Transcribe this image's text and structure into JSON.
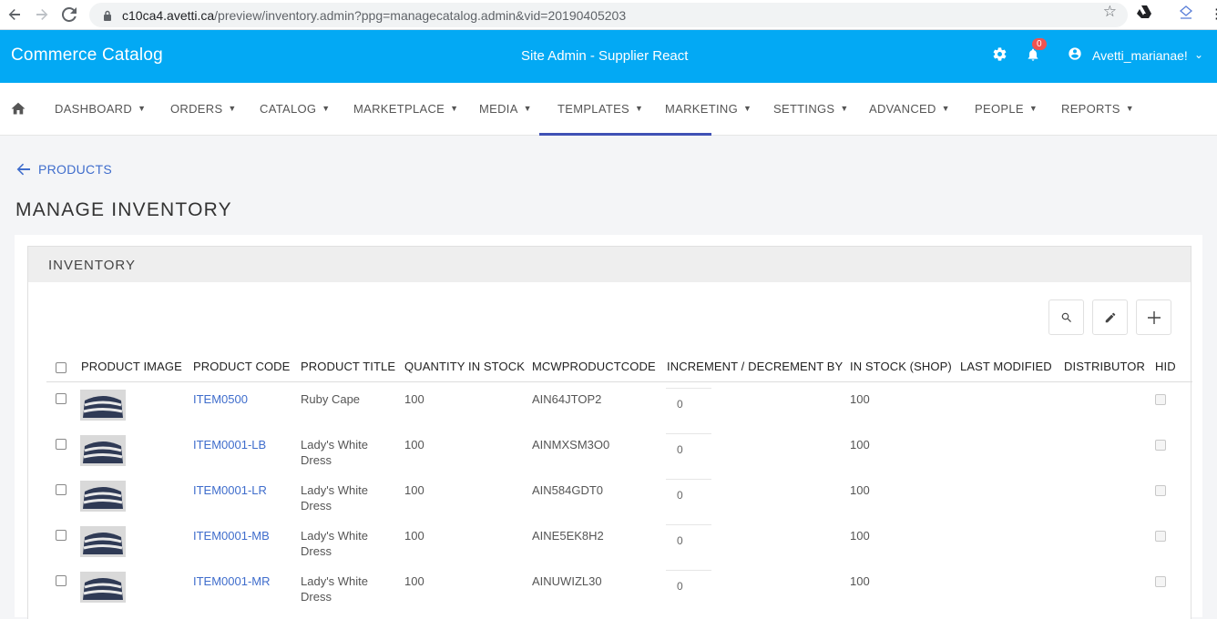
{
  "browser": {
    "url_host": "c10ca4.avetti.ca",
    "url_path": "/preview/inventory.admin?ppg=managecatalog.admin&vid=20190405203"
  },
  "header": {
    "app_title": "Commerce Catalog",
    "site_title": "Site Admin - Supplier React",
    "notification_count": "0",
    "user_name": "Avetti_marianae!",
    "brand_color": "#03a9f4"
  },
  "nav": {
    "items": [
      {
        "label": "DASHBOARD"
      },
      {
        "label": "ORDERS"
      },
      {
        "label": "CATALOG"
      },
      {
        "label": "MARKETPLACE"
      },
      {
        "label": "MEDIA"
      },
      {
        "label": "TEMPLATES"
      },
      {
        "label": "MARKETING"
      },
      {
        "label": "SETTINGS"
      },
      {
        "label": "ADVANCED"
      },
      {
        "label": "PEOPLE"
      },
      {
        "label": "REPORTS"
      }
    ],
    "active": "TEMPLATES"
  },
  "page": {
    "back_label": "PRODUCTS",
    "title": "MANAGE INVENTORY",
    "card_title": "INVENTORY"
  },
  "table": {
    "columns": [
      "PRODUCT IMAGE",
      "PRODUCT CODE",
      "PRODUCT TITLE",
      "QUANTITY IN STOCK",
      "MCWPRODUCTCODE",
      "INCREMENT / DECREMENT BY",
      "IN STOCK (SHOP)",
      "LAST MODIFIED",
      "DISTRIBUTOR",
      "HID"
    ],
    "rows": [
      {
        "code": "ITEM0500",
        "title": "Ruby Cape",
        "qty": "100",
        "mcw": "AIN64JTOP2",
        "inc": "0",
        "in_stock": "100"
      },
      {
        "code": "ITEM0001-LB",
        "title": "Lady's White Dress",
        "qty": "100",
        "mcw": "AINMXSM3O0",
        "inc": "0",
        "in_stock": "100"
      },
      {
        "code": "ITEM0001-LR",
        "title": "Lady's White Dress",
        "qty": "100",
        "mcw": "AIN584GDT0",
        "inc": "0",
        "in_stock": "100"
      },
      {
        "code": "ITEM0001-MB",
        "title": "Lady's White Dress",
        "qty": "100",
        "mcw": "AINE5EK8H2",
        "inc": "0",
        "in_stock": "100"
      },
      {
        "code": "ITEM0001-MR",
        "title": "Lady's White Dress",
        "qty": "100",
        "mcw": "AINUWIZL30",
        "inc": "0",
        "in_stock": "100"
      }
    ]
  }
}
